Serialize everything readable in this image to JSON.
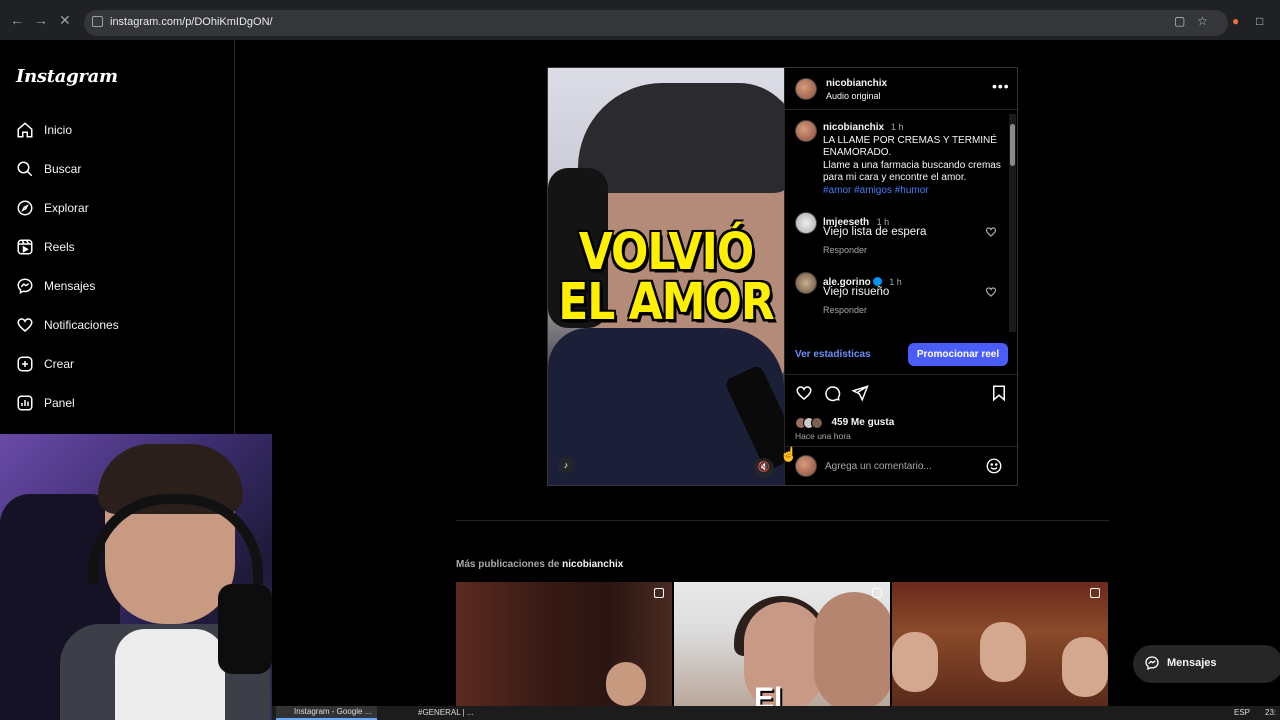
{
  "browser": {
    "url": "instagram.com/p/DOhiKmIDgON/",
    "back_icon": "arrow-left-icon",
    "forward_icon": "arrow-right-icon",
    "reload_icon": "close-icon"
  },
  "sidebar": {
    "logo": "Instagram",
    "items": [
      {
        "label": "Inicio",
        "icon": "home-icon"
      },
      {
        "label": "Buscar",
        "icon": "search-icon"
      },
      {
        "label": "Explorar",
        "icon": "compass-icon"
      },
      {
        "label": "Reels",
        "icon": "reels-icon"
      },
      {
        "label": "Mensajes",
        "icon": "messenger-icon"
      },
      {
        "label": "Notificaciones",
        "icon": "heart-icon"
      },
      {
        "label": "Crear",
        "icon": "plus-square-icon"
      },
      {
        "label": "Panel",
        "icon": "chart-icon"
      }
    ]
  },
  "post": {
    "overlay_line1": "VOLVIÓ",
    "overlay_line2": "EL AMOR",
    "author": "nicobianchix",
    "audio": "Audio original",
    "caption": {
      "author": "nicobianchix",
      "time": "1 h",
      "line1": "LA LLAME POR CREMAS Y TERMINÉ ENAMORADO.",
      "line2": "Llame a una farmacia buscando cremas para mi cara y encontre el amor.",
      "hashtags": "#amor #amigos #humor"
    },
    "comments": [
      {
        "user": "lmjeeseth",
        "time": "1 h",
        "text": "Viejo lista de espera",
        "reply": "Responder",
        "verified": false
      },
      {
        "user": "ale.gorino",
        "time": "1 h",
        "text": "Viejo risueño",
        "reply": "Responder",
        "verified": true
      }
    ],
    "stats_link": "Ver estadísticas",
    "promote_button": "Promocionar reel",
    "likes": "459 Me gusta",
    "posted": "Hace una hora",
    "comment_placeholder": "Agrega un comentario..."
  },
  "more": {
    "prefix": "Más publicaciones de",
    "user": "nicobianchix",
    "tile2_text": "El"
  },
  "messages_pill": "Mensajes",
  "taskbar": {
    "item1": "Instagram - Google ...",
    "item2": "#GENERAL | ...",
    "lang": "ESP",
    "clock": "23:"
  },
  "colors": {
    "accent": "#4a5df9",
    "link": "#6d8ff7",
    "hashtag": "#4a7df6",
    "overlay_text": "#ffef00"
  }
}
